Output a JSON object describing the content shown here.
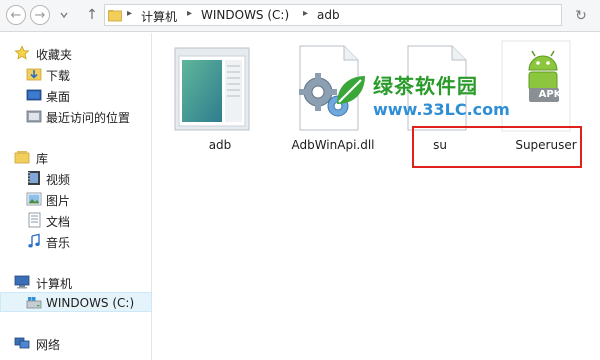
{
  "navigation": {
    "back_glyph": "←",
    "forward_glyph": "→",
    "up_glyph": "↑",
    "refresh_glyph": "↻",
    "breadcrumbs": [
      {
        "label": "计算机"
      },
      {
        "label": "WINDOWS (C:)"
      },
      {
        "label": "adb"
      }
    ]
  },
  "sidebar": {
    "favorites": {
      "label": "收藏夹",
      "icon": "star-icon",
      "items": [
        {
          "label": "下载",
          "icon": "download-folder-icon"
        },
        {
          "label": "桌面",
          "icon": "desktop-icon"
        },
        {
          "label": "最近访问的位置",
          "icon": "recent-places-icon"
        }
      ]
    },
    "libraries": {
      "label": "库",
      "icon": "library-icon",
      "items": [
        {
          "label": "视频",
          "icon": "video-icon"
        },
        {
          "label": "图片",
          "icon": "pictures-icon"
        },
        {
          "label": "文档",
          "icon": "documents-icon"
        },
        {
          "label": "音乐",
          "icon": "music-icon"
        }
      ]
    },
    "computer": {
      "label": "计算机",
      "icon": "computer-icon",
      "items": [
        {
          "label": "WINDOWS (C:)",
          "icon": "drive-icon",
          "selected": true
        }
      ]
    },
    "network": {
      "label": "网络",
      "icon": "network-icon"
    }
  },
  "files": [
    {
      "name": "adb",
      "type": "folder",
      "icon": "folder-icon"
    },
    {
      "name": "AdbWinApi.dll",
      "type": "dll",
      "icon": "dll-gear-icon"
    },
    {
      "name": "su",
      "type": "file",
      "icon": "blank-file-icon"
    },
    {
      "name": "Superuser",
      "type": "apk",
      "icon": "apk-icon"
    }
  ],
  "watermark": {
    "title": "绿茶软件园",
    "url": "www.33LC.com"
  },
  "apk_badge": "APK",
  "colors": {
    "highlight_box": "#e0201b",
    "selected_bg": "#e5f3fb",
    "watermark_green": "#2a9b2a",
    "watermark_blue": "#2e8fd6"
  }
}
